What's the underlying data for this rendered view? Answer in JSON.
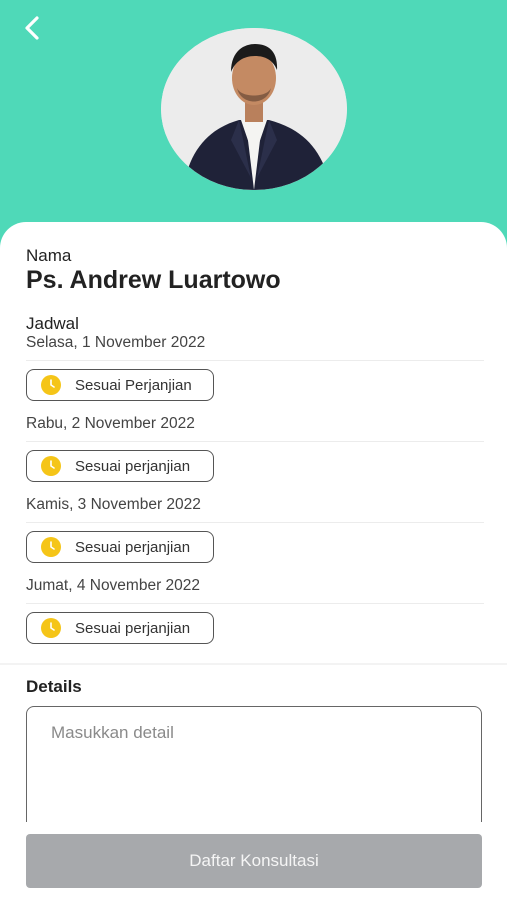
{
  "header": {
    "back_icon": "chevron-left-icon",
    "accent_color": "#4fd9b8",
    "avatar_alt": "profile-photo"
  },
  "profile": {
    "name_label": "Nama",
    "name": "Ps. Andrew Luartowo"
  },
  "schedule": {
    "label": "Jadwal",
    "days": [
      {
        "date": "Selasa, 1 November 2022",
        "slot": "Sesuai Perjanjian"
      },
      {
        "date": "Rabu, 2 November 2022",
        "slot": "Sesuai perjanjian"
      },
      {
        "date": "Kamis, 3 November 2022",
        "slot": "Sesuai perjanjian"
      },
      {
        "date": "Jumat, 4 November 2022",
        "slot": "Sesuai perjanjian"
      }
    ],
    "slot_icon": "clock-icon",
    "slot_icon_color": "#f5c518"
  },
  "details": {
    "label": "Details",
    "placeholder": "Masukkan detail",
    "value": ""
  },
  "footer": {
    "submit_label": "Daftar Konsultasi",
    "submit_color": "#a7a9ac"
  }
}
